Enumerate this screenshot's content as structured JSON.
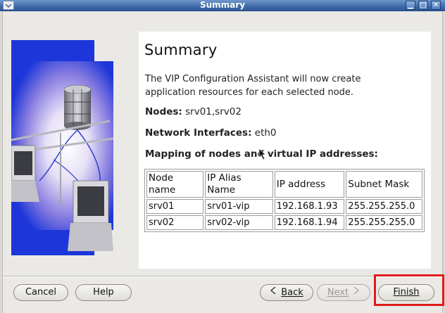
{
  "window": {
    "title": "Summary",
    "controls": [
      "minimize",
      "maximize",
      "close"
    ]
  },
  "panel": {
    "heading": "Summary",
    "description_line1": "The VIP Configuration Assistant will now create",
    "description_line2": "application resources for each selected node.",
    "nodes_label": "Nodes:",
    "nodes_value": "srv01,srv02",
    "interfaces_label": "Network Interfaces:",
    "interfaces_value": "eth0",
    "mapping_title": "Mapping of nodes and virtual IP addresses:"
  },
  "table": {
    "headers": {
      "node_line1": "Node",
      "node_line2": "name",
      "alias_line1": "IP Alias",
      "alias_line2": "Name",
      "ip": "IP address",
      "mask": "Subnet Mask"
    },
    "rows": [
      {
        "node": "srv01",
        "alias": "srv01-vip",
        "ip": "192.168.1.93",
        "mask": "255.255.255.0"
      },
      {
        "node": "srv02",
        "alias": "srv02-vip",
        "ip": "192.168.1.94",
        "mask": "255.255.255.0"
      }
    ]
  },
  "buttons": {
    "cancel": "Cancel",
    "help": "Help",
    "back": "Back",
    "next": "Next",
    "finish": "Finish"
  },
  "colors": {
    "titlebar": "#3f6aa6",
    "highlight": "#e01b1b",
    "graphic_blue": "#1c36d9"
  }
}
